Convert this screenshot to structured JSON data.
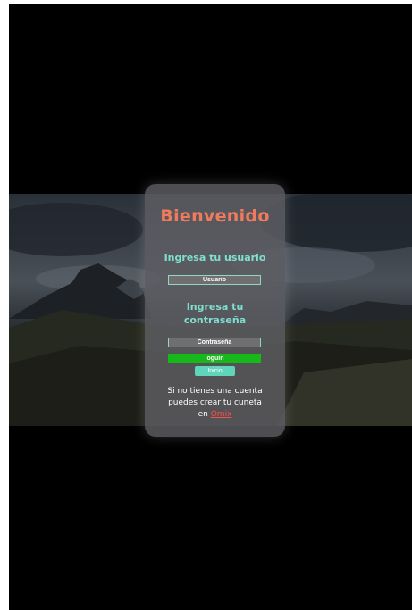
{
  "login": {
    "title": "Bienvenido",
    "user_label": "Ingresa tu usuario",
    "user_placeholder": "Usuario",
    "pass_label_line1": "Ingresa tu",
    "pass_label_line2": "contraseña",
    "pass_placeholder": "Contraseña",
    "login_button": "loguin",
    "home_button": "Inicio",
    "note_line1": "Si no tienes una cuenta",
    "note_line2": "puedes crear tu cuneta",
    "note_prefix": "en",
    "register_link": "Omix"
  },
  "colors": {
    "title": "#f07b5c",
    "label": "#7fe0cf",
    "login_button": "#16b81a",
    "home_button": "#5fd5bb",
    "link": "#ff4d4d"
  }
}
